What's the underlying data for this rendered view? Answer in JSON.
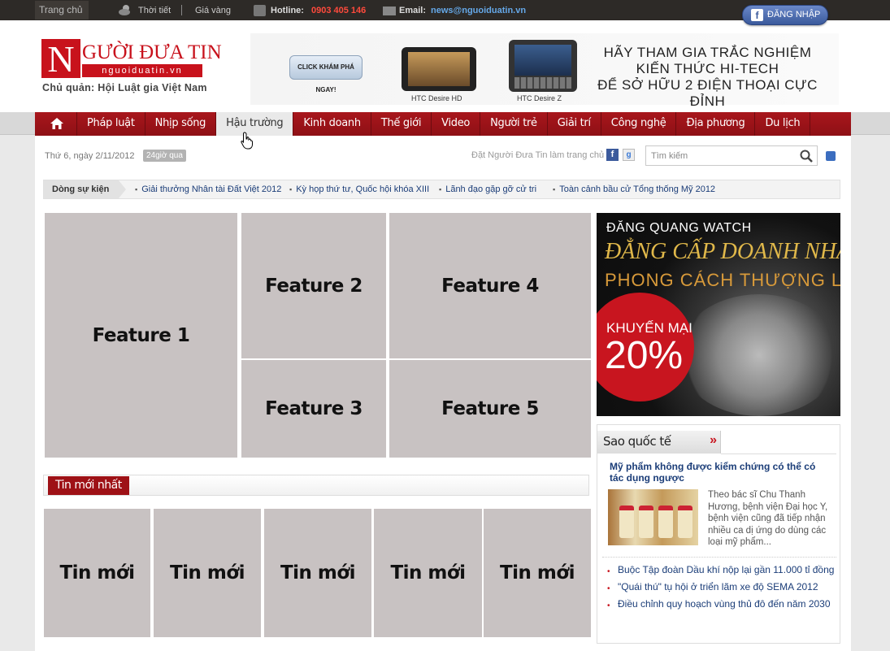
{
  "topbar": {
    "home": "Trang chủ",
    "weather": "Thời tiết",
    "gold": "Giá vàng",
    "hotline_label": "Hotline:",
    "hotline": "0903 405 146",
    "email_label": "Email:",
    "email": "news@nguoiduatin.vn",
    "fb_login": "ĐĂNG NHẬP"
  },
  "logo": {
    "letter": "N",
    "brand": "GƯỜI ĐƯA TIN",
    "domain": "nguoiduatin.vn",
    "owner": "Chủ quản: Hội Luật gia Việt Nam"
  },
  "banner": {
    "cta": "CLICK KHÁM PHÁ NGAY!",
    "phone1": "HTC Desire HD",
    "phone2": "HTC Desire Z",
    "line1": "HÃY THAM GIA TRẮC NGHIỆM",
    "line2": "KIẾN THỨC HI-TECH",
    "line3": "ĐỂ SỞ HỮU 2 ĐIỆN THOẠI CỰC ĐỈNH"
  },
  "nav": [
    "Pháp luật",
    "Nhịp sống",
    "Hậu trường",
    "Kinh doanh",
    "Thế giới",
    "Video",
    "Người trẻ",
    "Giải trí",
    "Công nghệ",
    "Địa phương",
    "Du lịch"
  ],
  "nav_active": "Hậu trường",
  "toolbar": {
    "date": "Thứ 6, ngày 2/11/2012",
    "badge": "24giờ qua",
    "make_home": "Đặt Người Đưa Tin làm trang chủ",
    "search_placeholder": "Tìm kiếm"
  },
  "events": {
    "label": "Dòng sự kiện",
    "items": [
      "Giải thưởng Nhân tài Đất Việt 2012",
      "Kỳ họp thứ tư, Quốc hội khóa XIII",
      "Lãnh đạo gặp gỡ cử tri",
      "Toàn cảnh bầu cử Tổng thống Mỹ 2012"
    ]
  },
  "features": [
    "Feature 1",
    "Feature 2",
    "Feature 4",
    "Feature 3",
    "Feature 5"
  ],
  "ad": {
    "brand": "ĐĂNG QUANG WATCH",
    "slogan1": "ĐẲNG CẤP DOANH NHÂN",
    "slogan2": "PHONG CÁCH THƯỢNG LƯU",
    "promo": "KHUYẾN MẠI",
    "percent": "20%"
  },
  "sidebox": {
    "header": "Sao quốc tế",
    "title": "Mỹ phẩm không được kiểm chứng có thể có tác dụng ngược",
    "summary": "Theo bác sĩ Chu Thanh Hương, bệnh viện Đại học Y, bệnh viện cũng đã tiếp nhận nhiều ca dị ứng do dùng các loại mỹ phẩm...",
    "links": [
      "Buộc Tập đoàn Dầu khí nộp lại gần 11.000 tỉ đồng",
      "\"Quái thú\" tụ hội ở triển lãm xe độ SEMA 2012",
      "Điều chỉnh quy hoạch vùng thủ đô đến năm 2030"
    ]
  },
  "latest": {
    "header": "Tin mới nhất",
    "items": [
      "Tin mới",
      "Tin mới",
      "Tin mới",
      "Tin mới",
      "Tin mới"
    ]
  },
  "colors": {
    "brand_red": "#c8121c",
    "nav_red": "#9e1116",
    "link_blue": "#1b3d78",
    "placeholder_gray": "#c8c2c2"
  }
}
